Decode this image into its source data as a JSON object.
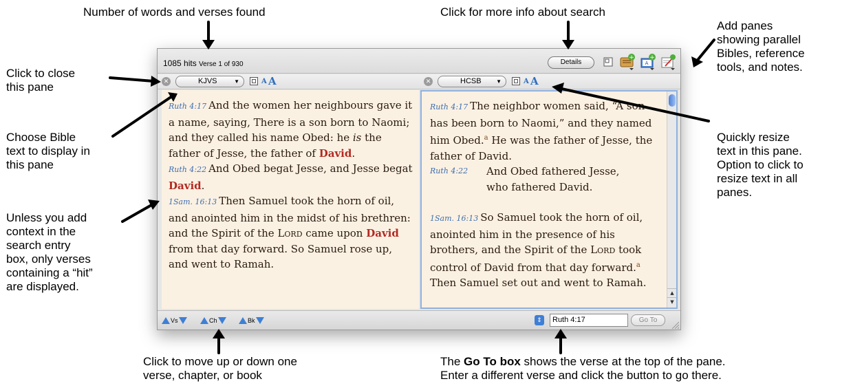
{
  "callouts": {
    "top_words": "Number of words and verses found",
    "top_info": "Click for more info about search",
    "add_panes": "Add panes\nshowing parallel\nBibles, reference\ntools, and notes.",
    "close_pane": "Click to close\nthis pane",
    "choose_text": "Choose Bible\ntext to display in\nthis pane",
    "context": "Unless you add\ncontext in the\nsearch entry\nbox, only verses\ncontaining a “hit”\nare displayed.",
    "resize": "Quickly resize\ntext in this pane.\nOption to click to\nresize text in all\npanes.",
    "move_nav": "Click to move up or down one\nverse, chapter, or book",
    "goto_bold": "Go To box",
    "goto_prefix": "The ",
    "goto_rest": " shows the verse at the top of the pane.",
    "goto_line2": "Enter a different verse and click the button to go there."
  },
  "toolbar": {
    "hits": "1085 hits",
    "verse_of": "Verse 1 of 930",
    "details": "Details"
  },
  "panes": {
    "left": {
      "bible": "KJVS",
      "verses": {
        "v1_ref": "Ruth 4:17",
        "v1_text": "And the women her neighbours gave it a name, saying, There is a son born to Naomi; and they called his name Obed: he ",
        "v1_is": "is",
        "v1_text2": " the father of Jesse, the father of ",
        "v1_hit": "David",
        "v1_end": ".",
        "v2_ref": "Ruth 4:22",
        "v2_text": "And Obed begat Jesse, and Jesse begat ",
        "v2_hit": "David",
        "v2_end": ".",
        "v3_ref": "1Sam. 16:13",
        "v3_text": "Then Samuel took the horn of oil, and anointed him in the midst of his brethren: and the Spirit of the ",
        "v3_lord": "Lord",
        "v3_text2": " came upon ",
        "v3_hit": "David",
        "v3_text3": " from that day forward. So Samuel rose up, and went to Ramah."
      }
    },
    "right": {
      "bible": "HCSB",
      "verses": {
        "v1_ref": "Ruth 4:17",
        "v1_text": "The neighbor women said, “A son has been born to Naomi,” and they named him Obed.",
        "v1_fn": "a",
        "v1_text2": " He was the father of Jesse, the father of David.",
        "v2_ref": "Ruth 4:22",
        "v2_line1": "And Obed fathered Jesse,",
        "v2_line2": "who fathered David.",
        "v3_ref": "1Sam. 16:13",
        "v3_text": "So Samuel took the horn of oil, anointed him in the presence of his brothers, and the Spirit of the ",
        "v3_lord": "Lord",
        "v3_text2": " took control of David from that day forward.",
        "v3_fn": "a",
        "v3_text3": " Then Samuel set out and went to Ramah."
      }
    }
  },
  "statusbar": {
    "vs": "Vs",
    "ch": "Ch",
    "bk": "Bk",
    "goto_value": "Ruth 4:17",
    "goto_button": "Go To"
  },
  "icons": [
    "close-icon",
    "pane-split-icon",
    "scroll-icon",
    "book-icon",
    "notes-icon",
    "stepper-icon",
    "resize-grip-icon"
  ],
  "colors": {
    "accent": "#3f7fd5",
    "hit": "#b22a22",
    "reference": "#3d6fb0",
    "pane_bg": "#fbf1e3"
  }
}
